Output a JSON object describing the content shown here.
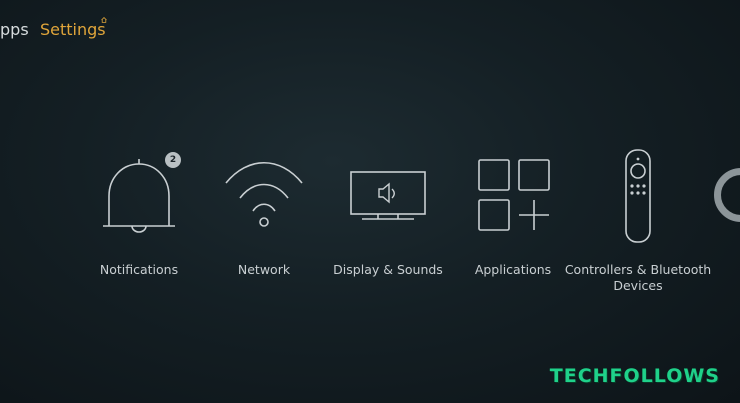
{
  "nav": {
    "prev_label": "pps",
    "current_label": "Settings"
  },
  "tiles": [
    {
      "label": "Notifications",
      "icon": "bell-icon",
      "badge": "2"
    },
    {
      "label": "Network",
      "icon": "wifi-icon"
    },
    {
      "label": "Display & Sounds",
      "icon": "tv-speaker-icon"
    },
    {
      "label": "Applications",
      "icon": "apps-grid-icon"
    },
    {
      "label": "Controllers & Bluetooth Devices",
      "icon": "remote-control-icon"
    }
  ],
  "watermark": "TECHFOLLOWS",
  "colors": {
    "accent": "#e0a53a",
    "background": "#141f24",
    "watermark": "#1fd18a"
  }
}
